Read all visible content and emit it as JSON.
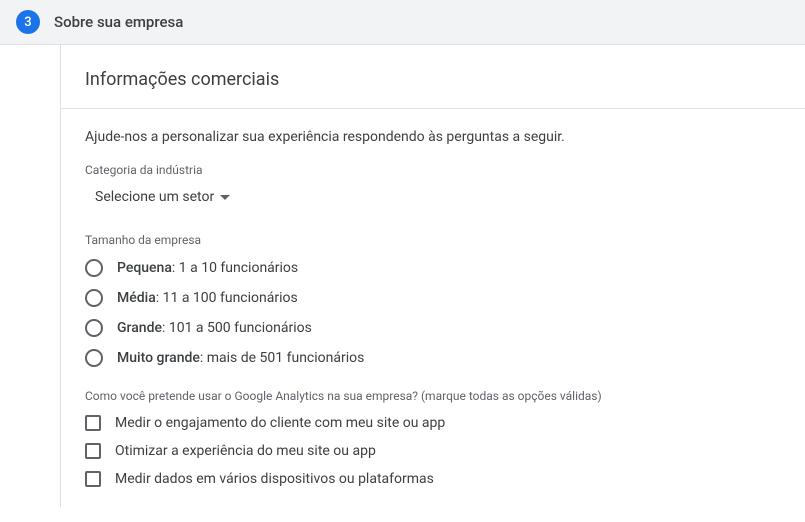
{
  "step": {
    "number": "3",
    "title": "Sobre sua empresa"
  },
  "card": {
    "title": "Informações comerciais",
    "intro": "Ajude-nos a personalizar sua experiência respondendo às perguntas a seguir.",
    "industry": {
      "label": "Categoria da indústria",
      "placeholder": "Selecione um setor"
    },
    "size": {
      "label": "Tamanho da empresa",
      "options": [
        {
          "bold": "Pequena",
          "rest": ": 1 a 10 funcionários"
        },
        {
          "bold": "Média",
          "rest": ": 11 a 100 funcionários"
        },
        {
          "bold": "Grande",
          "rest": ": 101 a 500 funcionários"
        },
        {
          "bold": "Muito grande",
          "rest": ": mais de 501 funcionários"
        }
      ]
    },
    "usage": {
      "label": "Como você pretende usar o Google Analytics na sua empresa? (marque todas as opções válidas)",
      "options": [
        "Medir o engajamento do cliente com meu site ou app",
        "Otimizar a experiência do meu site ou app",
        "Medir dados em vários dispositivos ou plataformas"
      ]
    }
  }
}
